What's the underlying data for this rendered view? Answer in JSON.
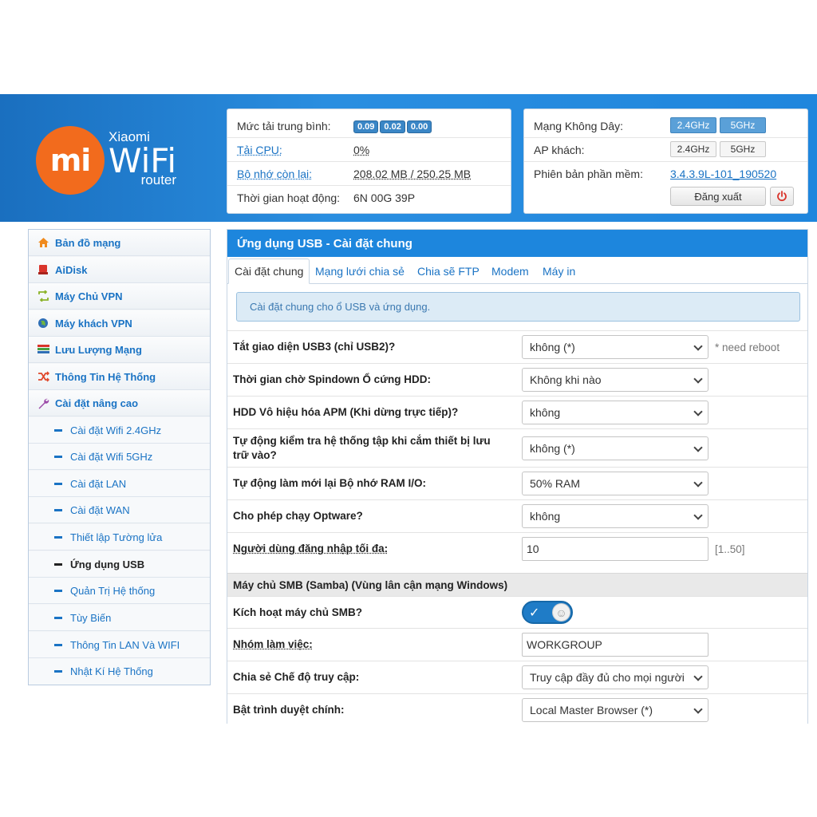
{
  "logo": {
    "brand": "Xiaomi",
    "mi": "mi",
    "wifi": "WiFi",
    "router": "router"
  },
  "status": {
    "load_label": "Mức tải trung bình:",
    "load_values": [
      "0.09",
      "0.02",
      "0.00"
    ],
    "cpu_label": "Tải CPU:",
    "cpu_value": "0%",
    "mem_label": "Bộ nhớ còn lại:",
    "mem_value": "208.02 MB / 250.25 MB",
    "uptime_label": "Thời gian hoạt động:",
    "uptime_value": "6N 00G 39P"
  },
  "wireless": {
    "network_label": "Mạng Không Dây:",
    "ap_label": "AP khách:",
    "band_24": "2.4GHz",
    "band_5": "5GHz",
    "firmware_label": "Phiên bản phần mềm:",
    "firmware_value": "3.4.3.9L-101_190520",
    "logout_label": "Đăng xuất"
  },
  "sidebar": {
    "items": [
      {
        "label": "Bản đồ mạng",
        "icon": "home-icon"
      },
      {
        "label": "AiDisk",
        "icon": "disk-icon"
      },
      {
        "label": "Máy Chủ VPN",
        "icon": "vpn-server-icon"
      },
      {
        "label": "Máy khách VPN",
        "icon": "globe-icon"
      },
      {
        "label": "Lưu Lượng Mạng",
        "icon": "traffic-icon"
      },
      {
        "label": "Thông Tin Hệ Thống",
        "icon": "shuffle-icon"
      },
      {
        "label": "Cài đặt nâng cao",
        "icon": "wrench-icon"
      }
    ],
    "subitems": [
      "Cài đặt Wifi 2.4GHz",
      "Cài đặt Wifi 5GHz",
      "Cài đặt LAN",
      "Cài đặt WAN",
      "Thiết lập Tường lửa",
      "Ứng dụng USB",
      "Quản Trị Hệ thống",
      "Tùy Biến",
      "Thông Tin LAN Và WIFI",
      "Nhật Kí Hệ Thống"
    ]
  },
  "main": {
    "title": "Ứng dụng USB - Cài đặt chung",
    "tabs": [
      "Cài đặt chung",
      "Mạng lưới chia sẻ",
      "Chia sẽ FTP",
      "Modem",
      "Máy in"
    ],
    "notice": "Cài đặt chung cho ổ USB và ứng dụng.",
    "settings": [
      {
        "label": "Tắt giao diện USB3 (chỉ USB2)?",
        "value": "không (*)",
        "hint": "* need reboot"
      },
      {
        "label": "Thời gian chờ Spindown Ổ cứng HDD:",
        "value": "Không khi nào"
      },
      {
        "label": "HDD Vô hiệu hóa APM (Khi dừng trực tiếp)?",
        "value": "không"
      },
      {
        "label": "Tự động kiểm tra hệ thống tập khi cắm thiết bị lưu trữ vào?",
        "value": "không (*)"
      },
      {
        "label": "Tự động làm mới lại Bộ nhớ RAM I/O:",
        "value": "50% RAM"
      },
      {
        "label": "Cho phép chạy Optware?",
        "value": "không"
      },
      {
        "label": "Người dùng đăng nhập tối đa:",
        "value": "10",
        "hint": "[1..50]"
      }
    ],
    "smb_section": "Máy chủ SMB (Samba) (Vùng lân cận mạng Windows)",
    "smb": [
      {
        "label": "Kích hoạt máy chủ SMB?"
      },
      {
        "label": "Nhóm làm việc:",
        "value": "WORKGROUP"
      },
      {
        "label": "Chia sẻ Chế độ truy cập:",
        "value": "Truy cập đầy đủ cho mọi người"
      },
      {
        "label": "Bật trình duyệt chính:",
        "value": "Local Master Browser (*)"
      }
    ]
  },
  "colors": {
    "header_blue": "#1d86dd",
    "logo_orange": "#f26b1d",
    "link_blue": "#1a73c4"
  }
}
